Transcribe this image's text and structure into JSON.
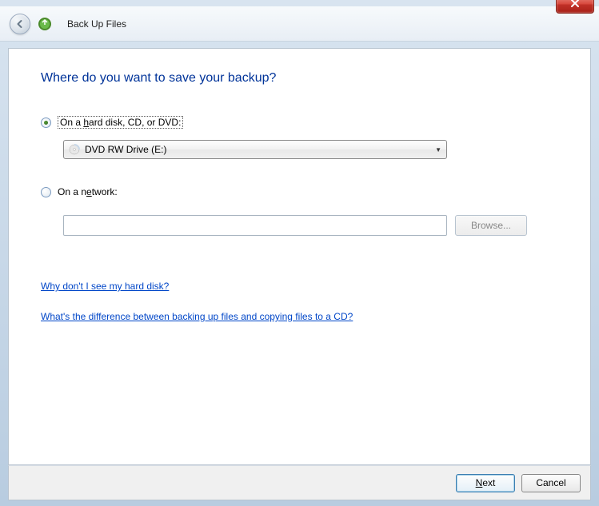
{
  "window": {
    "close_label": "X"
  },
  "header": {
    "title": "Back Up Files"
  },
  "page": {
    "title": "Where do you want to save your backup?",
    "option1_prefix": "On a ",
    "option1_key": "h",
    "option1_rest": "ard disk, CD, or DVD:",
    "dropdown_value": "DVD RW Drive (E:)",
    "option2_prefix": "On a n",
    "option2_key": "e",
    "option2_rest": "twork:",
    "network_path": "",
    "browse_label": "Browse...",
    "link1": "Why don't I see my hard disk?",
    "link2": "What's the difference between backing up files and copying files to a CD?"
  },
  "footer": {
    "next_key": "N",
    "next_rest": "ext",
    "cancel_label": "Cancel"
  }
}
